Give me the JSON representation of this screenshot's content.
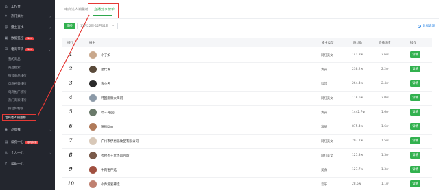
{
  "sidebar": {
    "items": [
      {
        "label": "工作台",
        "icon": "home-icon",
        "glyph": "⌂"
      },
      {
        "label": "热门素材",
        "icon": "fire-icon",
        "glyph": "✦",
        "caret": "›"
      },
      {
        "label": "播主查找",
        "icon": "user-search-icon",
        "glyph": "☺",
        "caret": "›"
      },
      {
        "label": "数据监控",
        "icon": "monitor-icon",
        "glyph": "▣",
        "badge": "New",
        "caret": "›"
      },
      {
        "label": "电商带货",
        "icon": "cart-icon",
        "glyph": "⊞",
        "badge": "New",
        "caret": "⌄"
      }
    ],
    "sub_items": [
      {
        "label": "我的商品"
      },
      {
        "label": "商品搜索"
      },
      {
        "label": "抖音商品排行"
      },
      {
        "label": "电商视频排行"
      },
      {
        "label": "电商推广榜行"
      },
      {
        "label": "热门商家排行"
      },
      {
        "label": "抖音好物榜"
      },
      {
        "label": "电商达人销量榜"
      }
    ],
    "bottom_items": [
      {
        "label": "品牌推广",
        "icon": "bulb-icon",
        "glyph": "◈",
        "caret": "›"
      },
      {
        "label": "续费中心",
        "icon": "renew-icon",
        "glyph": "▤",
        "badge": "限时特惠"
      },
      {
        "label": "个人中心",
        "icon": "person-icon",
        "glyph": "♙",
        "caret": "›"
      },
      {
        "label": "帮助中心",
        "icon": "help-icon",
        "glyph": "?"
      }
    ]
  },
  "tabs": [
    {
      "label": "电商达人销量榜"
    },
    {
      "label": "直播分享榜单"
    }
  ],
  "toolbar": {
    "button_label": "日榜",
    "date_value": "11月22日-12月01日",
    "explain_label": "数据说明"
  },
  "table": {
    "headers": [
      "排行",
      "播主",
      "播主类型",
      "粉丝数",
      "直播场次",
      "操作"
    ],
    "rows": [
      {
        "rank": "1",
        "name": "小子如",
        "type": "网红美女",
        "fans": "141.8w",
        "count": "2.6w",
        "action": "详情",
        "avatar": "#c9a88c"
      },
      {
        "rank": "2",
        "name": "星代发",
        "type": "演员",
        "fans": "238.2w",
        "count": "2.2w",
        "action": "详情",
        "avatar": "#5a4a3a"
      },
      {
        "rank": "3",
        "name": "曹小名",
        "type": "科普",
        "fans": "264.4w",
        "count": "2.4w",
        "action": "详情",
        "avatar": "#2b2b2b"
      },
      {
        "rank": "4",
        "name": "韩国潮牌大简闲",
        "type": "网红美女",
        "fans": "118.6w",
        "count": "2.0w",
        "action": "详情",
        "avatar": "#8c9aa8"
      },
      {
        "rank": "5",
        "name": "叶三哥gg",
        "type": "演员",
        "fans": "1442.7w",
        "count": "1.6w",
        "action": "详情",
        "avatar": "#6a7a6a"
      },
      {
        "rank": "6",
        "name": "饼师Kim",
        "type": "演员",
        "fans": "875.4w",
        "count": "1.6w",
        "action": "详情",
        "avatar": "#b07a5a"
      },
      {
        "rank": "7",
        "name": "广州市伊惠化妆品有限公司",
        "type": "网红美女",
        "fans": "297.1w",
        "count": "1.5w",
        "action": "详情",
        "avatar": "#d8c8b8"
      },
      {
        "rank": "8",
        "name": "考妆杰王丝杰风咨询",
        "type": "网红美女",
        "fans": "125.3w",
        "count": "1.3w",
        "action": "详情",
        "avatar": "#7a5a4a"
      },
      {
        "rank": "9",
        "name": "牛肉窑严选",
        "type": "美食",
        "fans": "127.7w",
        "count": "1.3w",
        "action": "详情",
        "avatar": "#a05040"
      },
      {
        "rank": "10",
        "name": "小乔爱爱辣选",
        "type": "音乐",
        "fans": "28.5w",
        "count": "1.1w",
        "action": "详情",
        "avatar": "#c08070"
      }
    ]
  },
  "colors": {
    "sidebar_bg": "#23262e",
    "accent_green": "#32b14f",
    "annotation_red": "#e53935",
    "link_blue": "#3a8ee6"
  }
}
